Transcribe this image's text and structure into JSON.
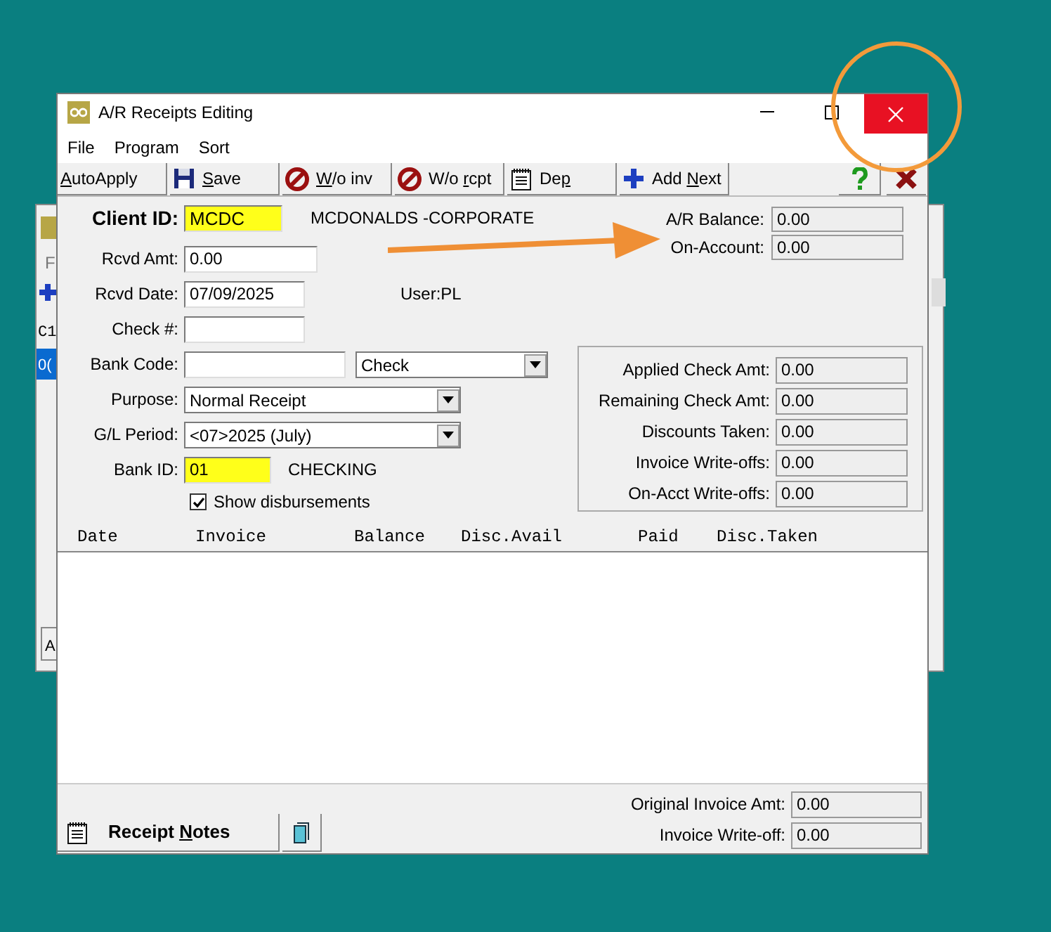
{
  "background_window": {
    "menu_text": "F",
    "column_text": "C1",
    "row_text": "0(",
    "button_text": "A"
  },
  "window": {
    "title": "A/R Receipts Editing"
  },
  "menu": [
    "File",
    "Program",
    "Sort"
  ],
  "toolbar": [
    {
      "key": "A",
      "post": "utoApply",
      "kind": "plain"
    },
    {
      "key": "S",
      "post": "ave",
      "kind": "save"
    },
    {
      "key": "W",
      "post": "/o inv",
      "kind": "writeoff"
    },
    {
      "pre": "W/o ",
      "key": "r",
      "post": "cpt",
      "kind": "writeoff"
    },
    {
      "pre": "De",
      "key": "p",
      "kind": "deposit"
    },
    {
      "pre": "Add ",
      "key": "N",
      "post": "ext",
      "kind": "add"
    }
  ],
  "form": {
    "client": {
      "label": "Client ID:",
      "value": "MCDC",
      "highlight": true,
      "name": "MCDONALDS -CORPORATE"
    },
    "fields": [
      {
        "kind": "text",
        "label": "Rcvd Amt:",
        "value": "0.00"
      },
      {
        "kind": "text",
        "label": "Rcvd Date:",
        "value": "07/09/2025",
        "note": "User:PL"
      },
      {
        "kind": "text",
        "label": "Check #:"
      },
      {
        "kind": "bank",
        "label": "Bank Code:",
        "select": "Check"
      },
      {
        "kind": "select",
        "label": "Purpose:",
        "value": "Normal Receipt"
      },
      {
        "kind": "select",
        "label": "G/L Period:",
        "value": "<07>2025 (July)"
      },
      {
        "kind": "text",
        "label": "Bank ID:",
        "value": "01",
        "highlight": true,
        "note": "CHECKING"
      }
    ],
    "checkbox": {
      "label": "Show disbursements",
      "checked": true
    },
    "balances": [
      {
        "label": "A/R Balance:",
        "value": "0.00"
      },
      {
        "label": "On-Account:",
        "value": "0.00"
      }
    ],
    "summary": [
      {
        "label": "Applied Check Amt:",
        "value": "0.00"
      },
      {
        "label": "Remaining Check Amt:",
        "value": "0.00"
      },
      {
        "label": "Discounts Taken:",
        "value": "0.00"
      },
      {
        "label": "Invoice Write-offs:",
        "value": "0.00"
      },
      {
        "label": "On-Acct Write-offs:",
        "value": "0.00"
      }
    ]
  },
  "table": {
    "columns": [
      "Date",
      "Invoice",
      "Balance",
      "Disc.Avail",
      "Paid",
      "Disc.Taken"
    ]
  },
  "footer": {
    "notes_button": {
      "pre": "Receipt ",
      "key": "N",
      "post": "otes"
    },
    "totals": [
      {
        "label": "Original Invoice Amt:",
        "value": "0.00"
      },
      {
        "label": "Invoice Write-off:",
        "value": "0.00"
      }
    ]
  }
}
